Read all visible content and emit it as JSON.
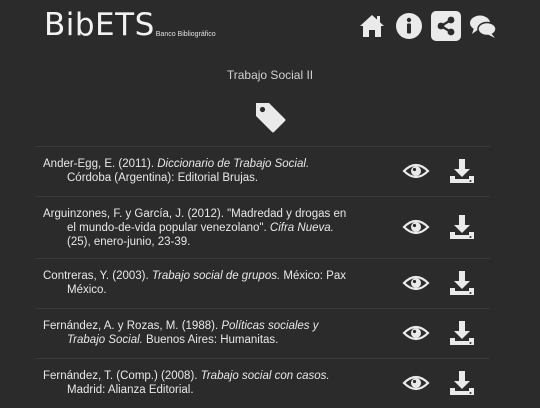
{
  "header": {
    "logo_main": "BibETS",
    "logo_sub": "Banco Bibliográfico",
    "nav": [
      "home-icon",
      "info-icon",
      "share-icon",
      "chat-icon"
    ]
  },
  "section": {
    "title": "Trabajo Social II",
    "icon": "tag-icon"
  },
  "references": [
    {
      "l1a": "Ander-Egg, E. (2011). ",
      "l1i": "Diccionario de Trabajo Social.",
      "l2a": "Córdoba (Argentina): Editorial Brujas."
    },
    {
      "l1a": "Arguinzones, F. y García, J. (2012). \"Madredad y drogas en",
      "l2a": "el mundo-de-vida popular venezolano\". ",
      "l2i": "Cifra Nueva.",
      "l3a": "(25), enero-junio, 23-39."
    },
    {
      "l1a": "Contreras, Y. (2003). ",
      "l1i": "Trabajo social de grupos.",
      "l1b": " México: Pax",
      "l2a": "México."
    },
    {
      "l1a": "Fernández, A. y Rozas, M. (1988). ",
      "l1i": "Políticas sociales y",
      "l2i": "Trabajo Social.",
      "l2b": " Buenos Aires: Humanitas."
    },
    {
      "l1a": "Fernández, T. (Comp.) (2008). ",
      "l1i": "Trabajo social con casos.",
      "l2a": "Madrid: Alianza Editorial."
    }
  ],
  "actions": {
    "view_icon": "eye-icon",
    "download_icon": "download-icon"
  },
  "colors": {
    "background": "#2b2b2b",
    "icon": "#eaeaea",
    "text": "#e6e6e6"
  }
}
